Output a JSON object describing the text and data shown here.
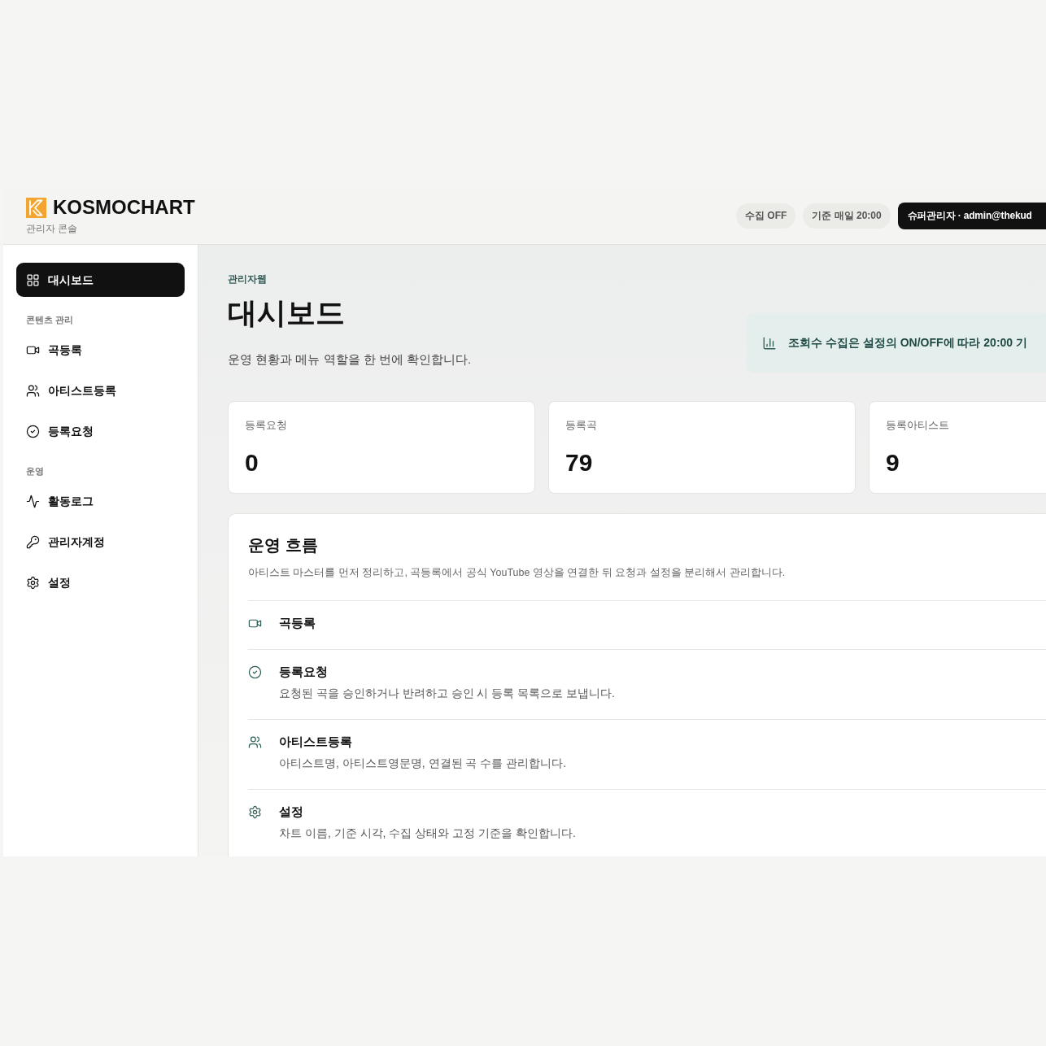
{
  "header": {
    "brand": "KOSMOCHART",
    "subtitle": "관리자 콘솔",
    "pills": [
      {
        "kind": "status",
        "label": "수집 OFF"
      },
      {
        "kind": "status",
        "label": "기준 매일 20:00"
      },
      {
        "kind": "account",
        "label": "슈퍼관리자 · admin@thekud"
      }
    ]
  },
  "sidebar": {
    "sections": [
      {
        "items": [
          {
            "kind": "dashboard",
            "label": "대시보드",
            "selected": true
          }
        ]
      },
      {
        "title": "콘텐츠 관리",
        "items": [
          {
            "kind": "songs",
            "label": "곡등록",
            "selected": false
          },
          {
            "kind": "artists",
            "label": "아티스트등록",
            "selected": false
          },
          {
            "kind": "requests",
            "label": "등록요청",
            "selected": false
          }
        ]
      },
      {
        "title": "운영",
        "items": [
          {
            "kind": "activity",
            "label": "활동로그",
            "selected": false
          },
          {
            "kind": "accounts",
            "label": "관리자계정",
            "selected": false
          },
          {
            "kind": "settings",
            "label": "설정",
            "selected": false
          }
        ]
      }
    ]
  },
  "main": {
    "eyebrow": "관리자웹",
    "title": "대시보드",
    "description": "운영 현황과 메뉴 역할을 한 번에 확인합니다.",
    "notice": "조회수 수집은 설정의 ON/OFF에 따라 20:00 기",
    "stats": [
      {
        "label": "등록요청",
        "value": "0"
      },
      {
        "label": "등록곡",
        "value": "79"
      },
      {
        "label": "등록아티스트",
        "value": "9"
      }
    ],
    "flow": {
      "title": "운영 흐름",
      "description": "아티스트 마스터를 먼저 정리하고, 곡등록에서 공식 YouTube 영상을 연결한 뒤 요청과 설정을 분리해서 관리합니다.",
      "steps": [
        {
          "kind": "songs",
          "title": "곡등록"
        },
        {
          "kind": "requests",
          "title": "등록요청",
          "description": "요청된 곡을 승인하거나 반려하고 승인 시 등록 목록으로 보냅니다."
        },
        {
          "kind": "artists",
          "title": "아티스트등록",
          "description": "아티스트명, 아티스트영문명, 연결된 곡 수를 관리합니다."
        },
        {
          "kind": "settings",
          "title": "설정",
          "description": "차트 이름, 기준 시각, 수집 상태와 고정 기준을 확인합니다."
        }
      ]
    }
  }
}
